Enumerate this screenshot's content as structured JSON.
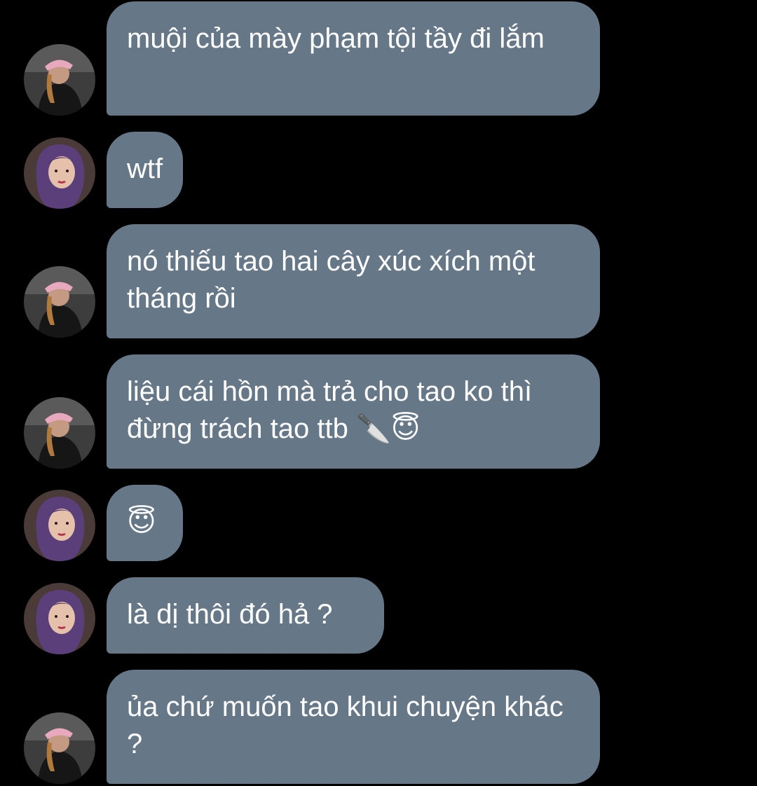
{
  "conversation": {
    "messages": [
      {
        "sender": "other-a",
        "text": "muội của mày phạm tội tầy đi lắm"
      },
      {
        "sender": "other-b",
        "text": "wtf"
      },
      {
        "sender": "other-a",
        "text": "nó thiếu tao hai cây xúc xích một tháng rồi"
      },
      {
        "sender": "other-a",
        "text": "liệu cái hồn mà trả cho tao ko thì đừng trách tao ttb 🔪😇"
      },
      {
        "sender": "other-b",
        "text": "😇"
      },
      {
        "sender": "other-b",
        "text": "là dị thôi đó hả ?"
      },
      {
        "sender": "other-a",
        "text": "ủa chứ muốn tao khui chuyện khác ?"
      }
    ]
  },
  "icons": {
    "avatar_a": "avatar-person-pink-cap",
    "avatar_b": "avatar-person-purple-hair"
  },
  "colors": {
    "background": "#000000",
    "bubble": "#667788",
    "text": "#ffffff"
  }
}
